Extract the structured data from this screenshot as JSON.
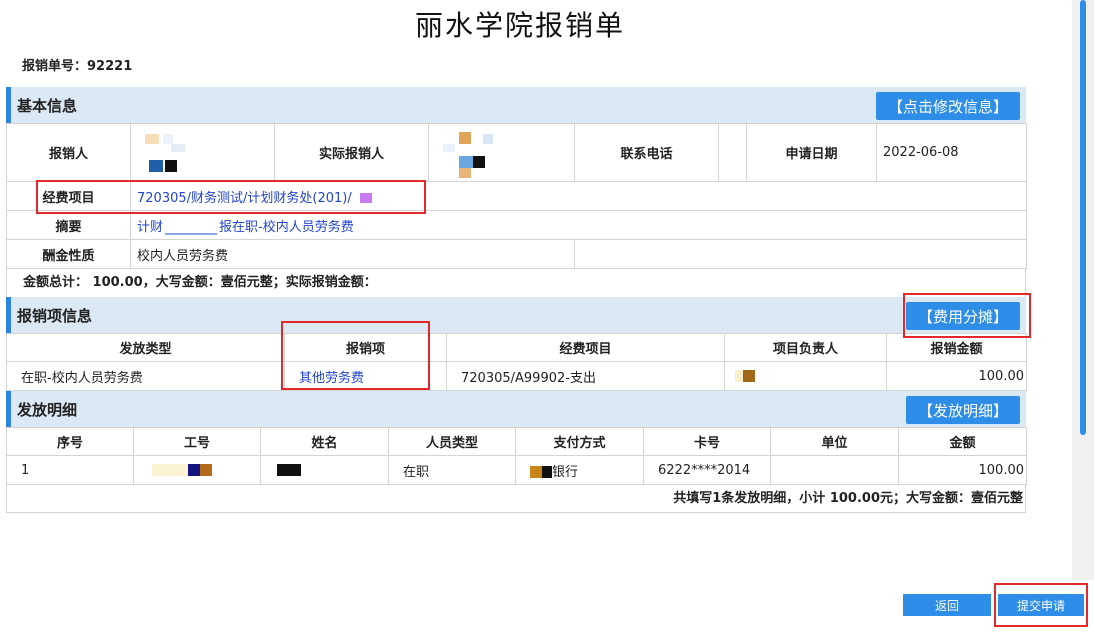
{
  "page": {
    "title": "丽水学院报销单",
    "order_no_label": "报销单号：",
    "order_no": "92221"
  },
  "basic": {
    "section_title": "基本信息",
    "edit_button": "【点击修改信息】",
    "applicant_label": "报销人",
    "actual_label": "实际报销人",
    "phone_label": "联系电话",
    "date_label": "申请日期",
    "date_value": "2022-06-08",
    "fund_label": "经费项目",
    "fund_value": "720305/财务测试/计划财务处(201)/",
    "summary_label": "摘要",
    "summary_value_a": "计财",
    "summary_value_b": "报在职-校内人员劳务费",
    "pay_nature_label": "酬金性质",
    "pay_nature_value": "校内人员劳务费",
    "amount_line": "金额总计： 100.00，大写金额：壹佰元整；实际报销金额："
  },
  "items": {
    "section_title": "报销项信息",
    "split_button": "【费用分摊】",
    "headers": [
      "发放类型",
      "报销项",
      "经费项目",
      "项目负责人",
      "报销金额"
    ],
    "row": {
      "type": "在职-校内人员劳务费",
      "item": "其他劳务费",
      "fund": "720305/A99902-支出",
      "amount": "100.00"
    }
  },
  "detail": {
    "section_title": "发放明细",
    "detail_button": "【发放明细】",
    "headers": [
      "序号",
      "工号",
      "姓名",
      "人员类型",
      "支付方式",
      "卡号",
      "单位",
      "金额"
    ],
    "row": {
      "seq": "1",
      "person_type": "在职",
      "pay_method": "银行",
      "card": "6222****2014",
      "amount": "100.00"
    },
    "summary": "共填写1条发放明细，小计 100.00元；大写金额：壹佰元整"
  },
  "footer": {
    "back": "返回",
    "submit": "提交申请"
  },
  "colors": {
    "accent": "#2e8de6",
    "section_bg": "#dbe9f5",
    "link": "#2345d0",
    "highlight": "#e32a2a"
  }
}
